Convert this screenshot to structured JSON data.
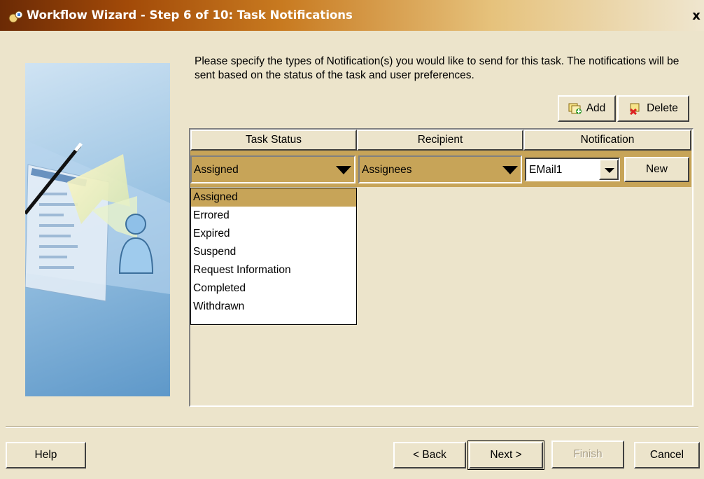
{
  "window": {
    "title": "Workflow Wizard - Step 6 of 10: Task Notifications",
    "close_label": "x"
  },
  "instructions": "Please specify the types of Notification(s) you would like to send for this task. The notifications will be sent based on the status of the task and user preferences.",
  "toolbar": {
    "add_label": "Add",
    "delete_label": "Delete"
  },
  "table": {
    "columns": [
      "Task Status",
      "Recipient",
      "Notification"
    ],
    "row": {
      "task_status": "Assigned",
      "recipient": "Assignees",
      "notification": "EMail1",
      "new_label": "New"
    }
  },
  "status_dropdown": {
    "options": [
      "Assigned",
      "Errored",
      "Expired",
      "Suspend",
      "Request Information",
      "Completed",
      "Withdrawn"
    ],
    "selected": "Assigned"
  },
  "footer": {
    "help_label": "Help",
    "back_label": "< Back",
    "next_label": "Next >",
    "finish_label": "Finish",
    "cancel_label": "Cancel"
  },
  "colors": {
    "background": "#ece4cb",
    "selection": "#c7a458",
    "title_dark": "#6b2a05"
  },
  "icons": {
    "title": "workflow-wizard-icon",
    "add": "add-notification-icon",
    "delete": "delete-notification-icon",
    "side_panel": "wizard-illustration"
  }
}
